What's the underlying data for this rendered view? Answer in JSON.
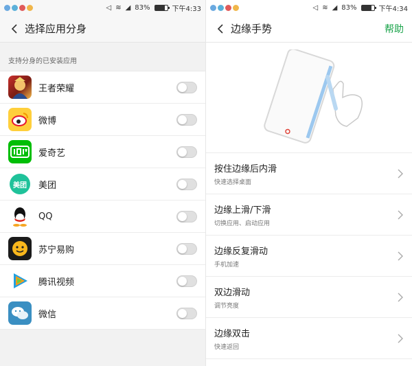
{
  "left": {
    "status": {
      "battery": "83%",
      "time": "下午4:33",
      "battery_level": 0.83
    },
    "header": {
      "title": "选择应用分身"
    },
    "section_label": "支持分身的已安装应用",
    "apps": [
      {
        "name": "王者荣耀",
        "icon": "honor-of-kings-icon",
        "enabled": false
      },
      {
        "name": "微博",
        "icon": "weibo-icon",
        "enabled": false
      },
      {
        "name": "爱奇艺",
        "icon": "iqiyi-icon",
        "enabled": false
      },
      {
        "name": "美团",
        "icon": "meituan-icon",
        "icon_text": "美团",
        "enabled": false
      },
      {
        "name": "QQ",
        "icon": "qq-icon",
        "enabled": false
      },
      {
        "name": "苏宁易购",
        "icon": "suning-icon",
        "enabled": false
      },
      {
        "name": "腾讯视频",
        "icon": "tencent-video-icon",
        "enabled": false
      },
      {
        "name": "微信",
        "icon": "wechat-icon",
        "enabled": false
      }
    ]
  },
  "right": {
    "status": {
      "battery": "83%",
      "time": "下午4:34",
      "battery_level": 0.83
    },
    "header": {
      "title": "边缘手势",
      "help": "帮助"
    },
    "gestures": [
      {
        "title": "按住边缘后内滑",
        "subtitle": "快速选择桌面"
      },
      {
        "title": "边缘上滑/下滑",
        "subtitle": "切换应用、启动应用"
      },
      {
        "title": "边缘反复滑动",
        "subtitle": "手机加速"
      },
      {
        "title": "双边滑动",
        "subtitle": "调节亮度"
      },
      {
        "title": "边缘双击",
        "subtitle": "快速返回"
      }
    ]
  },
  "colors": {
    "accent_green": "#1aa34a",
    "toggle_off": "#e0e0e0"
  }
}
